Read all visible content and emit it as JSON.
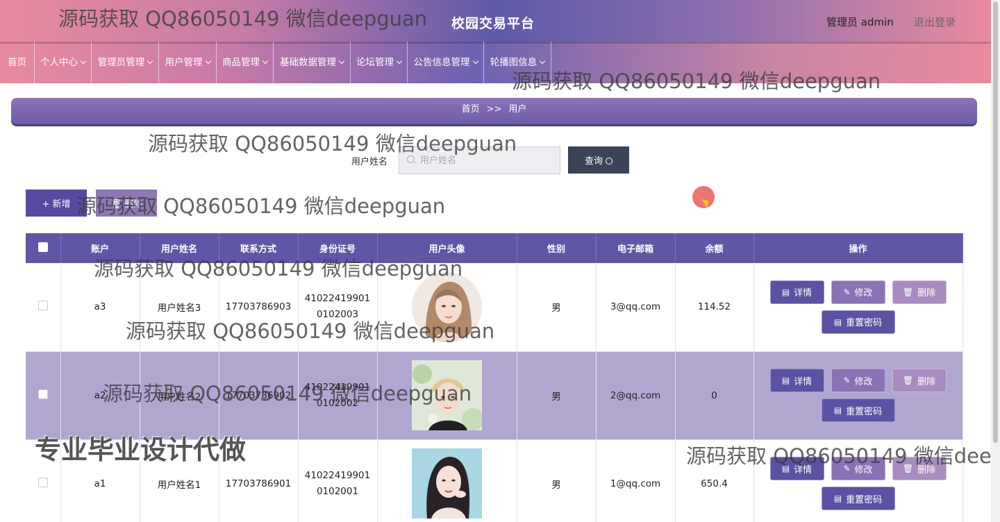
{
  "header": {
    "title": "校园交易平台",
    "admin": "管理员 admin",
    "logout": "退出登录"
  },
  "nav": [
    {
      "label": "首页",
      "dropdown": false
    },
    {
      "label": "个人中心",
      "dropdown": true
    },
    {
      "label": "管理员管理",
      "dropdown": true
    },
    {
      "label": "用户管理",
      "dropdown": true
    },
    {
      "label": "商品管理",
      "dropdown": true
    },
    {
      "label": "基础数据管理",
      "dropdown": true
    },
    {
      "label": "论坛管理",
      "dropdown": true
    },
    {
      "label": "公告信息管理",
      "dropdown": true
    },
    {
      "label": "轮播图信息",
      "dropdown": true
    }
  ],
  "breadcrumb": {
    "home": "首页",
    "sep": ">>",
    "current": "用户"
  },
  "search": {
    "label": "用户姓名",
    "placeholder": "用户姓名",
    "button": "查询"
  },
  "toolbar": {
    "add": "+ 新增",
    "delete": "删除"
  },
  "table": {
    "headers": [
      "账户",
      "用户姓名",
      "联系方式",
      "身份证号",
      "用户头像",
      "性别",
      "电子邮箱",
      "余额",
      "操作"
    ],
    "rows": [
      {
        "account": "a3",
        "name": "用户姓名3",
        "phone": "17703786903",
        "id1": "41022419901",
        "id2": "0102003",
        "gender": "男",
        "email": "3@qq.com",
        "balance": "114.52",
        "avatar": "woman-avatar"
      },
      {
        "account": "a2",
        "name": "用户姓名2",
        "phone": "17703786902",
        "id1": "41022419901",
        "id2": "0102002",
        "gender": "男",
        "email": "2@qq.com",
        "balance": "0",
        "avatar": "man-avatar"
      },
      {
        "account": "a1",
        "name": "用户姓名1",
        "phone": "17703786901",
        "id1": "41022419901",
        "id2": "0102001",
        "gender": "男",
        "email": "1@qq.com",
        "balance": "650.4",
        "avatar": "woman-avatar"
      }
    ],
    "actions": {
      "detail": "详情",
      "edit": "修改",
      "remove": "删除",
      "reset": "重置密码"
    }
  },
  "watermarks": {
    "text": "源码获取 QQ86050149 微信deepguan",
    "cut": "源码获取 QQ86050149 微信deep",
    "big": "专业毕业设计代做"
  },
  "colors": {
    "primary": "#5f57a6",
    "accent": "#e98b9f",
    "dark": "#3a4357"
  }
}
